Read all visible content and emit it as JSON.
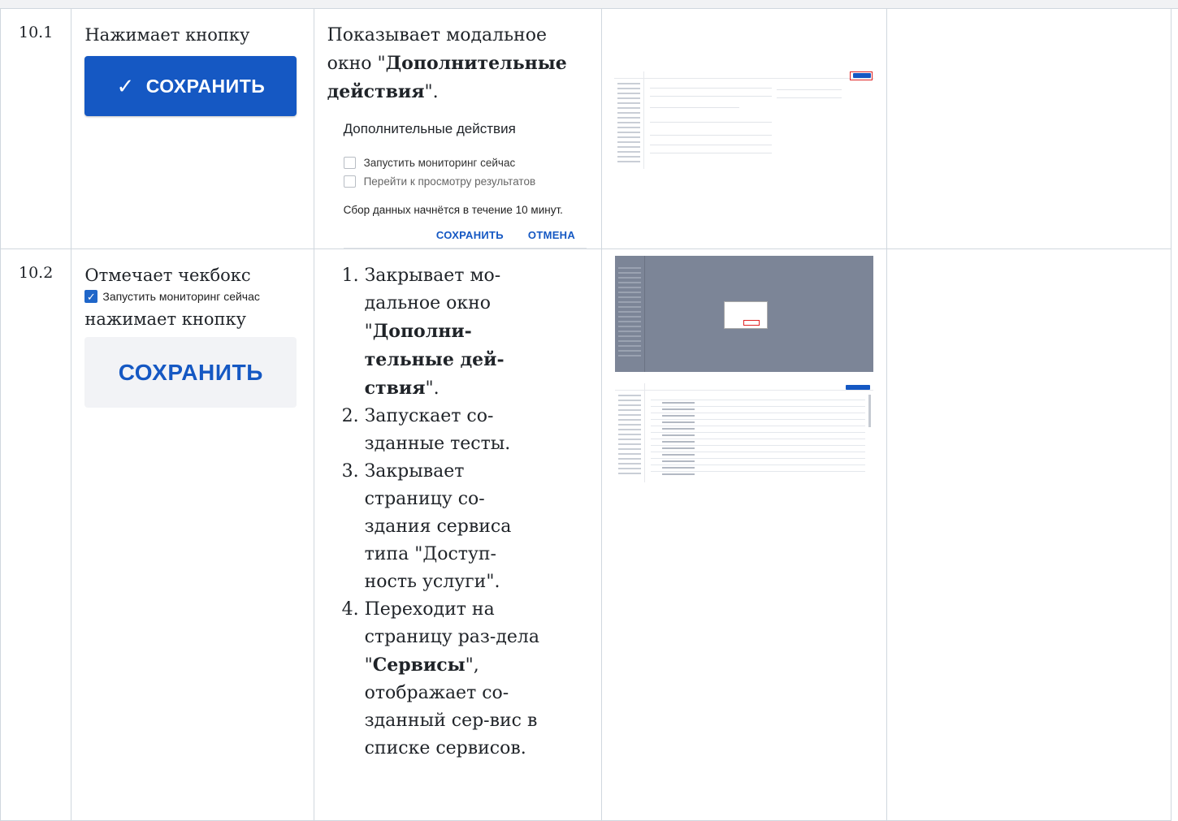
{
  "rows": [
    {
      "num": "10.1",
      "action_text": "Нажимает кнопку",
      "action_button": {
        "check": "✓",
        "label": "СОХРАНИТЬ"
      },
      "result_prefix": "Показывает модальное окно \"",
      "result_bold": "Дополнительные действия",
      "result_suffix": "\".",
      "modal": {
        "title": "Дополнительные действия",
        "checkbox1": "Запустить мониторинг сейчас",
        "checkbox2": "Перейти к просмотру результатов",
        "note": "Сбор данных начнётся в течение 10 минут.",
        "save": "СОХРАНИТЬ",
        "cancel": "ОТМЕНА"
      }
    },
    {
      "num": "10.2",
      "action_text1": "Отмечает чекбокс",
      "checkbox_label": "Запустить мониторинг сейчас",
      "action_text2": "нажимает кнопку",
      "action_button": "СОХРАНИТЬ",
      "results": [
        {
          "pre": "Закрывает мо-\nдальное окно \"",
          "bold": "Дополни-тельные дей-ствия",
          "post": "\"."
        },
        {
          "pre": "Запускает со-зданные тесты."
        },
        {
          "pre": "Закрывает страницу со-здания сервиса типа \"Доступ-ность услуги\"."
        },
        {
          "pre": "Переходит на страницу раз-дела \"",
          "bold": "Сервисы",
          "post": "\", отображает со-зданный сер-вис в списке сервисов."
        }
      ]
    }
  ]
}
